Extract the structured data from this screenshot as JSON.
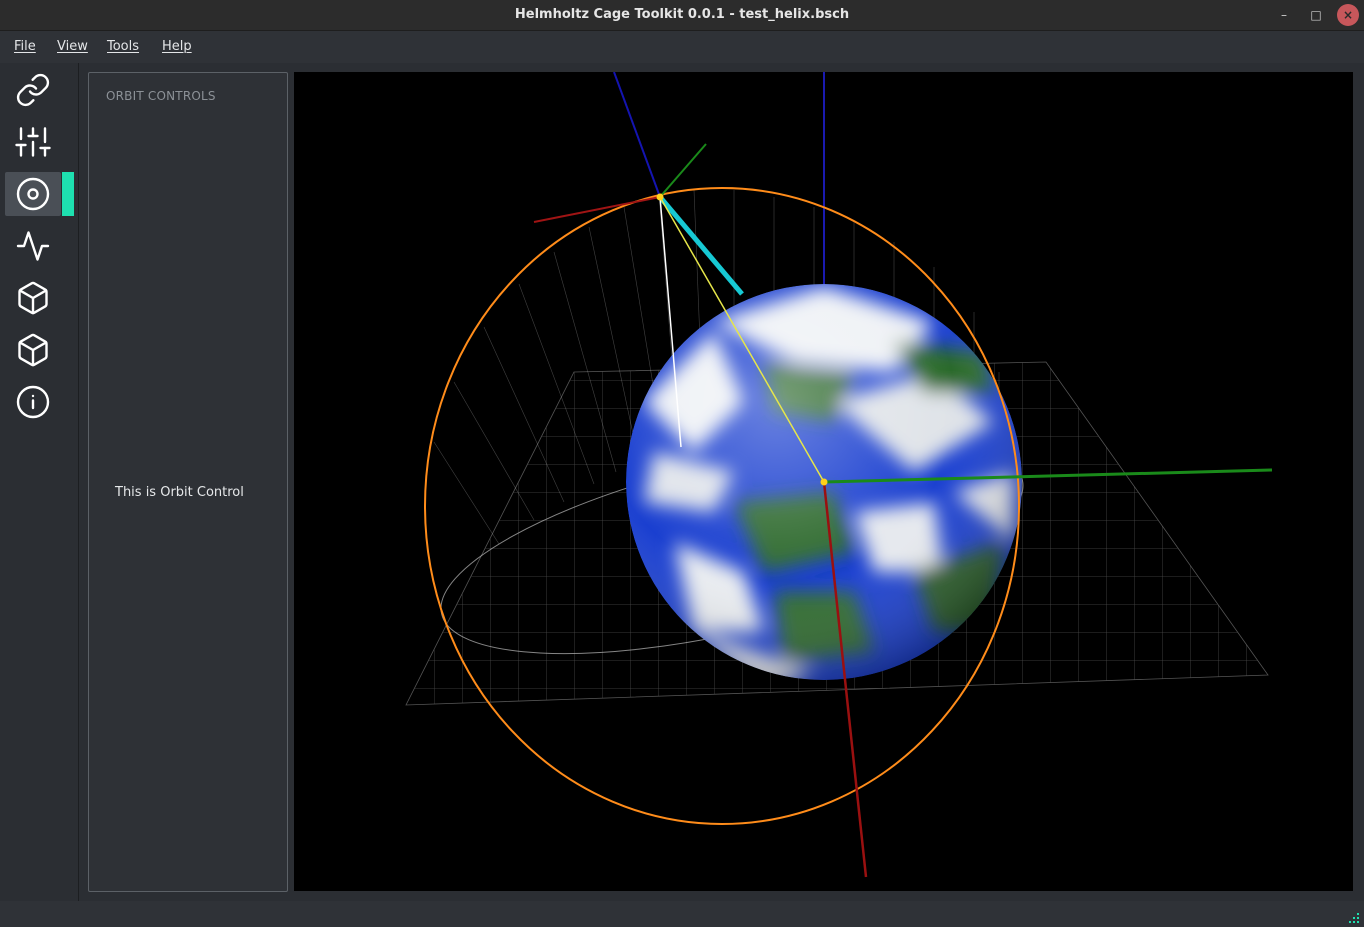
{
  "window": {
    "title": "Helmholtz Cage Toolkit 0.0.1 - test_helix.bsch",
    "minimize_icon": "minimize-icon",
    "maximize_icon": "maximize-icon",
    "close_icon": "close-icon"
  },
  "menubar": {
    "items": [
      "File",
      "View",
      "Tools",
      "Help"
    ]
  },
  "sidebar": {
    "items": [
      {
        "icon": "link-icon",
        "active": false
      },
      {
        "icon": "sliders-icon",
        "active": false
      },
      {
        "icon": "orbit-icon",
        "active": true
      },
      {
        "icon": "signal-icon",
        "active": false
      },
      {
        "icon": "cube-icon",
        "active": false
      },
      {
        "icon": "cube-icon",
        "active": false
      },
      {
        "icon": "info-icon",
        "active": false
      }
    ],
    "accent_color": "#1ee0b0"
  },
  "panel": {
    "title": "ORBIT CONTROLS",
    "body": "This is Orbit Control"
  },
  "viewport": {
    "background": "#000000",
    "orbit_color": "#ff8c1a",
    "vector_color": "#17c9d4",
    "axis_colors": {
      "x": "#b81414",
      "y": "#1a8a1a",
      "z": "#1414b0"
    }
  }
}
